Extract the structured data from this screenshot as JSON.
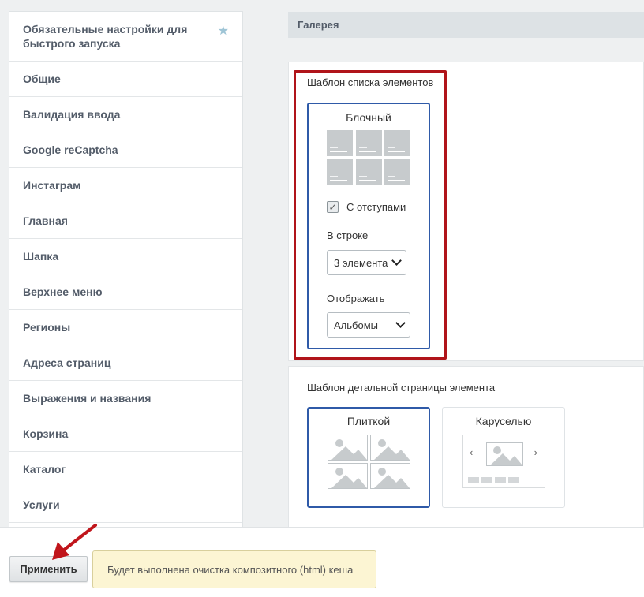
{
  "sidebar": {
    "star_icon": "★",
    "items": [
      {
        "label": "Обязательные настройки для быстрого запуска"
      },
      {
        "label": "Общие"
      },
      {
        "label": "Валидация ввода"
      },
      {
        "label": "Google reCaptcha"
      },
      {
        "label": "Инстаграм"
      },
      {
        "label": "Главная"
      },
      {
        "label": "Шапка"
      },
      {
        "label": "Верхнее меню"
      },
      {
        "label": "Регионы"
      },
      {
        "label": "Адреса страниц"
      },
      {
        "label": "Выражения и названия"
      },
      {
        "label": "Корзина"
      },
      {
        "label": "Каталог"
      },
      {
        "label": "Услуги"
      }
    ]
  },
  "section": {
    "title": "Галерея"
  },
  "list_template": {
    "label": "Шаблон списка элементов",
    "option_title": "Блочный",
    "checkbox_label": "С отступами",
    "checkbox_checked": true,
    "row_label": "В строке",
    "row_select_value": "3 элемента",
    "display_label": "Отображать",
    "display_select_value": "Альбомы"
  },
  "detail_template": {
    "label": "Шаблон детальной страницы элемента",
    "options": [
      {
        "title": "Плиткой",
        "selected": true
      },
      {
        "title": "Каруселью",
        "selected": false
      }
    ],
    "carousel_prev": "‹",
    "carousel_next": "›"
  },
  "footer": {
    "apply_label": "Применить",
    "notice_text": "Будет выполнена очистка композитного (html) кеша"
  },
  "colors": {
    "highlight_frame": "#b0141a",
    "selected_border": "#2f5aa8",
    "annotation_arrow": "#c0151b"
  }
}
